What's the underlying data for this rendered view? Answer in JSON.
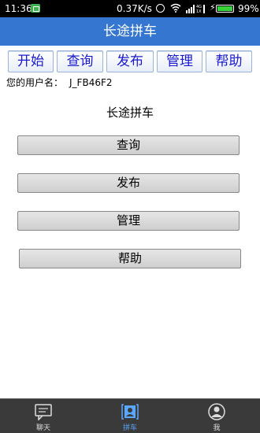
{
  "status_bar": {
    "time": "11:36",
    "speed": "0.37K/s",
    "battery": "99%"
  },
  "header": {
    "title": "长途拼车"
  },
  "top_nav": [
    "开始",
    "查询",
    "发布",
    "管理",
    "帮助"
  ],
  "user": {
    "label": "您的用户名：",
    "name": "J_FB46F2"
  },
  "main": {
    "heading": "长途拼车",
    "buttons": [
      "查询",
      "发布",
      "管理",
      "帮助"
    ]
  },
  "tabs": [
    {
      "label": "聊天",
      "icon": "chat-icon",
      "active": false
    },
    {
      "label": "拼车",
      "icon": "carpool-icon",
      "active": true
    },
    {
      "label": "我",
      "icon": "profile-icon",
      "active": false
    }
  ],
  "colors": {
    "title_bar": "#3576d0",
    "nav_text": "#1a1acc",
    "active_tab": "#5aa7ff"
  }
}
